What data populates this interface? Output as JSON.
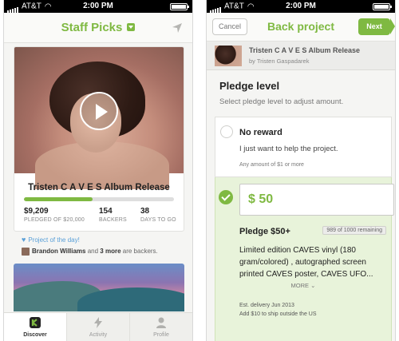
{
  "status": {
    "left_carrier": "AT&T",
    "left_time": "2:00 PM",
    "right_carrier": "AT&T",
    "right_time": "2:00 PM"
  },
  "left_screen": {
    "nav_title": "Staff Picks",
    "project": {
      "title": "Tristen C A V E S Album Release",
      "funded_fraction": 0.46,
      "stats": [
        {
          "value": "$9,209",
          "label": "PLEDGED OF $20,000"
        },
        {
          "value": "154",
          "label": "BACKERS"
        },
        {
          "value": "38",
          "label": "DAYS TO GO"
        }
      ]
    },
    "project_of_day": "Project of the day!",
    "backer_name": "Brandon Williams",
    "backer_middle": " and ",
    "backer_more": "3 more",
    "backer_suffix": " are backers.",
    "tabs": [
      {
        "label": "Discover",
        "icon": "kickstarter-k-icon"
      },
      {
        "label": "Activity",
        "icon": "lightning-icon"
      },
      {
        "label": "Profile",
        "icon": "person-icon"
      }
    ]
  },
  "right_screen": {
    "cancel_label": "Cancel",
    "nav_title": "Back project",
    "next_label": "Next",
    "project_title": "Tristen C A V E S Album Release",
    "project_by": "by Tristen Gaspadarek",
    "pledge_heading": "Pledge level",
    "pledge_subheading": "Select pledge level to adjust amount.",
    "no_reward": {
      "title": "No reward",
      "desc": "I just want to help the project.",
      "note": "Any amount of $1 or more"
    },
    "selected": {
      "amount": "$ 50",
      "title": "Pledge $50+",
      "remaining": "989 of 1000 remaining",
      "desc": "Limited edition CAVES vinyl (180 gram/colored) , autographed screen printed CAVES poster, CAVES UFO...",
      "more_label": "MORE",
      "delivery": "Est. delivery Jun 2013",
      "shipping": "Add $10 to ship outside the US"
    }
  },
  "colors": {
    "accent_green": "#7fb942",
    "link_blue": "#5aa0d8",
    "selected_bg": "#e8f3da"
  }
}
